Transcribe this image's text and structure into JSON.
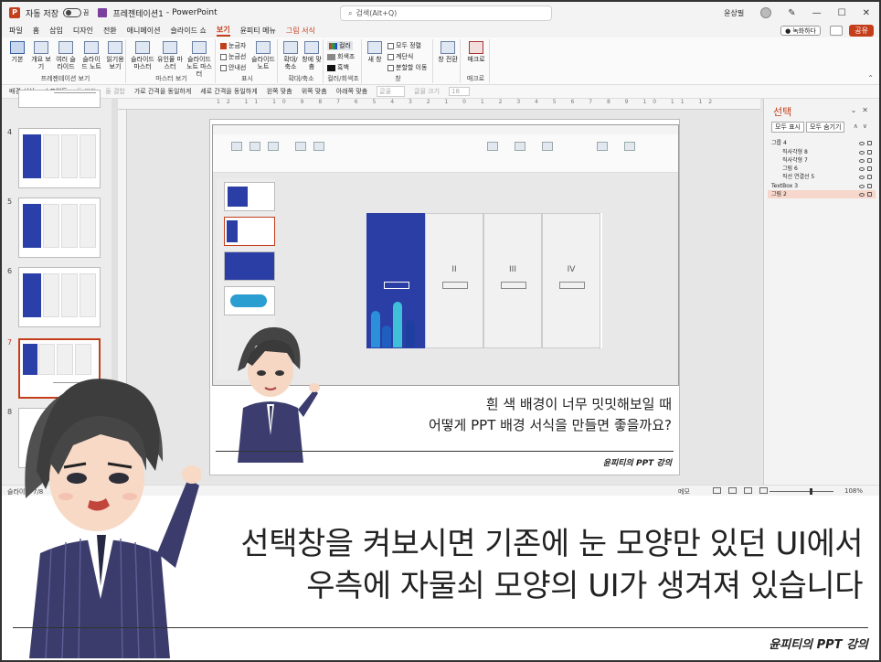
{
  "titlebar": {
    "autosave_label": "자동 저장",
    "autosave_state": "끔",
    "file_name": "프레젠테이션1",
    "app_name": "PowerPoint",
    "search_placeholder": "검색(Alt+Q)",
    "user": "윤상필"
  },
  "menu": {
    "tabs": [
      "파일",
      "홈",
      "삽입",
      "디자인",
      "전환",
      "애니메이션",
      "슬라이드 쇼",
      "보기",
      "윤피티 메뉴",
      "그림 서식"
    ],
    "active_tab": "보기",
    "record": "녹화하다",
    "share": "공유"
  },
  "ribbon": {
    "groups": [
      {
        "label": "프레젠테이션 보기",
        "buttons": [
          "기본",
          "개요 보기",
          "여러 슬라이드",
          "슬라이드 노트",
          "읽기용 보기"
        ]
      },
      {
        "label": "마스터 보기",
        "buttons": [
          "슬라이드 마스터",
          "유인물 마스터",
          "슬라이드 노트 마스터"
        ]
      },
      {
        "label": "표시",
        "checks": [
          "눈금자",
          "눈금선",
          "안내선"
        ],
        "buttons": [
          "슬라이드 노트"
        ]
      },
      {
        "label": "확대/축소",
        "buttons": [
          "확대/축소",
          "창에 맞춤"
        ]
      },
      {
        "label": "컬러/회색조",
        "options": [
          "컬러",
          "회색조",
          "흑백"
        ]
      },
      {
        "label": "창",
        "buttons": [
          "새 창"
        ],
        "options": [
          "모두 정렬",
          "계단식",
          "분할할 이동"
        ]
      },
      {
        "label": "",
        "buttons": [
          "창 전환"
        ]
      },
      {
        "label": "매크로",
        "buttons": [
          "매크로"
        ]
      }
    ],
    "checked": [
      "눈금자"
    ]
  },
  "quicktoolbar": {
    "items": [
      "배경 서식",
      "스포이트",
      "둘 병합",
      "둘 결합",
      "가로 간격을 동일하게",
      "세로 간격을 동일하게",
      "왼쪽 맞춤",
      "위쪽 맞춤",
      "아래쪽 맞춤"
    ],
    "disabled": [
      "둘 병합",
      "둘 결합"
    ],
    "font_label": "글꼴",
    "font_size_label": "글꼴 크기",
    "font_size": "18"
  },
  "thumbnails": {
    "numbers": [
      "4",
      "5",
      "6",
      "7",
      "8"
    ],
    "active": "7"
  },
  "slide": {
    "caption_line1": "흰 색 배경이 너무 밋밋해보일 때",
    "caption_line2": "어떻게 PPT 배경 서식을 만들면 좋을까요?",
    "brand": "윤피티의 PPT 강의",
    "inner_panels": [
      "",
      "II",
      "III",
      "IV"
    ]
  },
  "selection_pane": {
    "title": "선택",
    "show_all": "모두 표시",
    "hide_all": "모두 숨기기",
    "items": [
      {
        "name": "그룹 4",
        "level": 0,
        "highlighted": false
      },
      {
        "name": "직사각형 8",
        "level": 1,
        "highlighted": false
      },
      {
        "name": "직사각형 7",
        "level": 1,
        "highlighted": false
      },
      {
        "name": "그림 6",
        "level": 1,
        "highlighted": false
      },
      {
        "name": "직선 연결선 5",
        "level": 1,
        "highlighted": false
      },
      {
        "name": "TextBox 3",
        "level": 0,
        "highlighted": false
      },
      {
        "name": "그림 2",
        "level": 0,
        "highlighted": true
      }
    ]
  },
  "status": {
    "slide_info": "슬라이드 7/8",
    "notes": "메모",
    "zoom": "108%"
  },
  "caption": {
    "line1": "선택창을 켜보시면 기존에 눈 모양만 있던 UI에서",
    "line2": "우측에 자물쇠 모양의 UI가 생겨져 있습니다",
    "brand": "윤피티의 PPT 강의"
  },
  "colors": {
    "accent": "#c43e1c",
    "slide_blue": "#2a3ea5",
    "selection_highlight": "#f7d6cb"
  }
}
